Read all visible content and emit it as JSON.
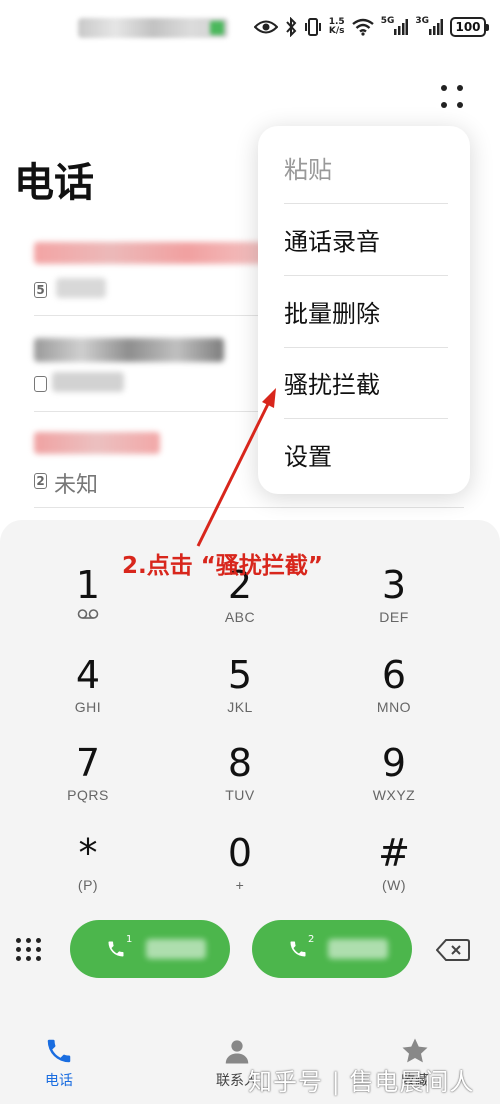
{
  "colors": {
    "accent": "#4cb64c",
    "annotation": "#d8261c",
    "tab_active": "#1a6de0"
  },
  "status_bar": {
    "speed_value": "1.5",
    "speed_unit": "K/s",
    "net1": "5G",
    "net2": "3G",
    "battery": "100"
  },
  "header": {
    "title": "电话"
  },
  "call_log": [
    {
      "sim": "5",
      "sub": ""
    },
    {
      "sim": "",
      "sub": ""
    },
    {
      "sim": "2",
      "sub": "未知"
    }
  ],
  "menu": {
    "items": [
      {
        "label": "粘贴"
      },
      {
        "label": "通话录音"
      },
      {
        "label": "批量删除"
      },
      {
        "label": "骚扰拦截"
      },
      {
        "label": "设置"
      }
    ]
  },
  "annotation": {
    "text": "2.点击 “骚扰拦截”"
  },
  "keypad": {
    "keys": [
      {
        "digit": "1",
        "letters": ""
      },
      {
        "digit": "2",
        "letters": "ABC"
      },
      {
        "digit": "3",
        "letters": "DEF"
      },
      {
        "digit": "4",
        "letters": "GHI"
      },
      {
        "digit": "5",
        "letters": "JKL"
      },
      {
        "digit": "6",
        "letters": "MNO"
      },
      {
        "digit": "7",
        "letters": "PQRS"
      },
      {
        "digit": "8",
        "letters": "TUV"
      },
      {
        "digit": "9",
        "letters": "WXYZ"
      },
      {
        "digit": "*",
        "letters": "(P)"
      },
      {
        "digit": "0",
        "letters": "+"
      },
      {
        "digit": "#",
        "letters": "(W)"
      }
    ]
  },
  "call_buttons": [
    {
      "sim": "1"
    },
    {
      "sim": "2"
    }
  ],
  "tabs": [
    {
      "label": "电话"
    },
    {
      "label": "联系人"
    },
    {
      "label": "收藏"
    }
  ],
  "watermark": "知乎号 | 售电晨间人",
  "icons": {
    "more": "more-dots-icon",
    "phone": "phone-icon",
    "contacts": "person-icon",
    "favorites": "star-icon",
    "backspace": "backspace-icon",
    "dialpad": "dialpad-icon",
    "voicemail": "voicemail-icon"
  }
}
